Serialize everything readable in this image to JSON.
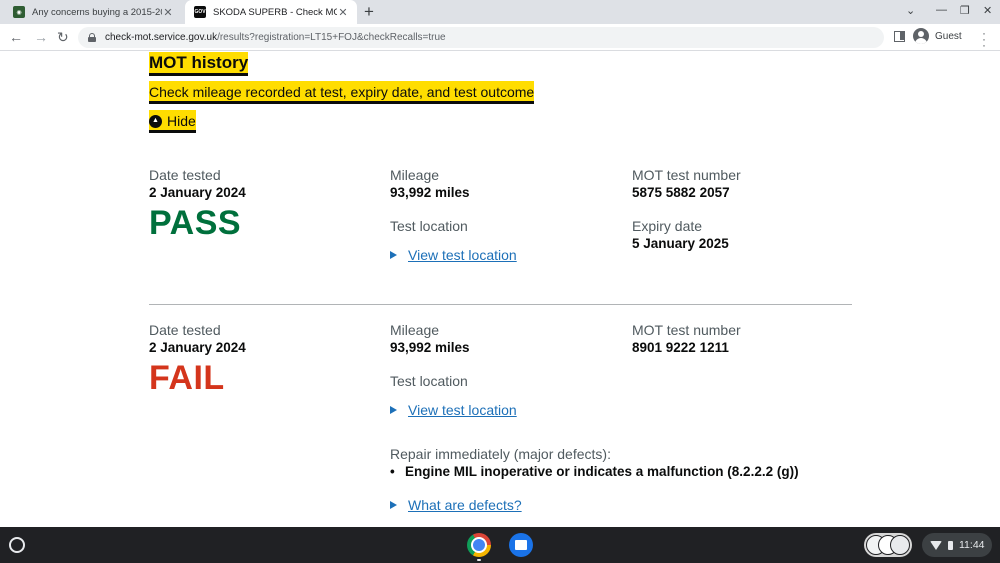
{
  "browser": {
    "tabs": [
      {
        "title": "Any concerns buying a 2015-2019",
        "active": false
      },
      {
        "title": "SKODA SUPERB - Check MOT his",
        "active": true
      }
    ],
    "new_tab_symbol": "+",
    "url_domain": "check-mot.service.gov.uk",
    "url_path": "/results?registration=LT15+FOJ&checkRecalls=true",
    "profile_label": "Guest"
  },
  "page": {
    "heading": "MOT history",
    "subheading": "Check mileage recorded at test, expiry date, and test outcome",
    "hide_label": "Hide",
    "tests": [
      {
        "date_label": "Date tested",
        "date": "2 January 2024",
        "result": "PASS",
        "mileage_label": "Mileage",
        "mileage": "93,992 miles",
        "location_label": "Test location",
        "location_link": "View test location",
        "test_number_label": "MOT test number",
        "test_number": "5875 5882 2057",
        "expiry_label": "Expiry date",
        "expiry": "5 January 2025"
      },
      {
        "date_label": "Date tested",
        "date": "2 January 2024",
        "result": "FAIL",
        "mileage_label": "Mileage",
        "mileage": "93,992 miles",
        "location_label": "Test location",
        "location_link": "View test location",
        "test_number_label": "MOT test number",
        "test_number": "8901 9222 1211",
        "defects_heading": "Repair immediately (major defects):",
        "defects": [
          "Engine MIL inoperative or indicates a malfunction (8.2.2.2 (g))"
        ],
        "defects_link": "What are defects?"
      }
    ]
  },
  "shelf": {
    "time": "11:44"
  },
  "colors": {
    "pass": "#00703c",
    "fail": "#d4351c",
    "link": "#1d70b8",
    "highlight": "#ffdd00"
  }
}
